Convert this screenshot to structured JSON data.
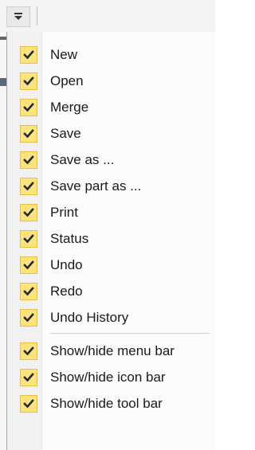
{
  "toolbar": {
    "customize_icon": "dropdown-arrow-icon"
  },
  "menu": {
    "group1": [
      {
        "label": "New",
        "checked": true
      },
      {
        "label": "Open",
        "checked": true
      },
      {
        "label": "Merge",
        "checked": true
      },
      {
        "label": "Save",
        "checked": true
      },
      {
        "label": "Save as ...",
        "checked": true
      },
      {
        "label": "Save part as ...",
        "checked": true
      },
      {
        "label": "Print",
        "checked": true
      },
      {
        "label": "Status",
        "checked": true
      },
      {
        "label": "Undo",
        "checked": true
      },
      {
        "label": "Redo",
        "checked": true
      },
      {
        "label": "Undo History",
        "checked": true
      }
    ],
    "group2": [
      {
        "label": "Show/hide menu bar",
        "checked": true
      },
      {
        "label": "Show/hide icon bar",
        "checked": true
      },
      {
        "label": "Show/hide tool bar",
        "checked": true
      }
    ]
  },
  "colors": {
    "check_fill": "#fde37a",
    "check_border": "#e3c04a",
    "check_mark": "#1c2a3a"
  }
}
